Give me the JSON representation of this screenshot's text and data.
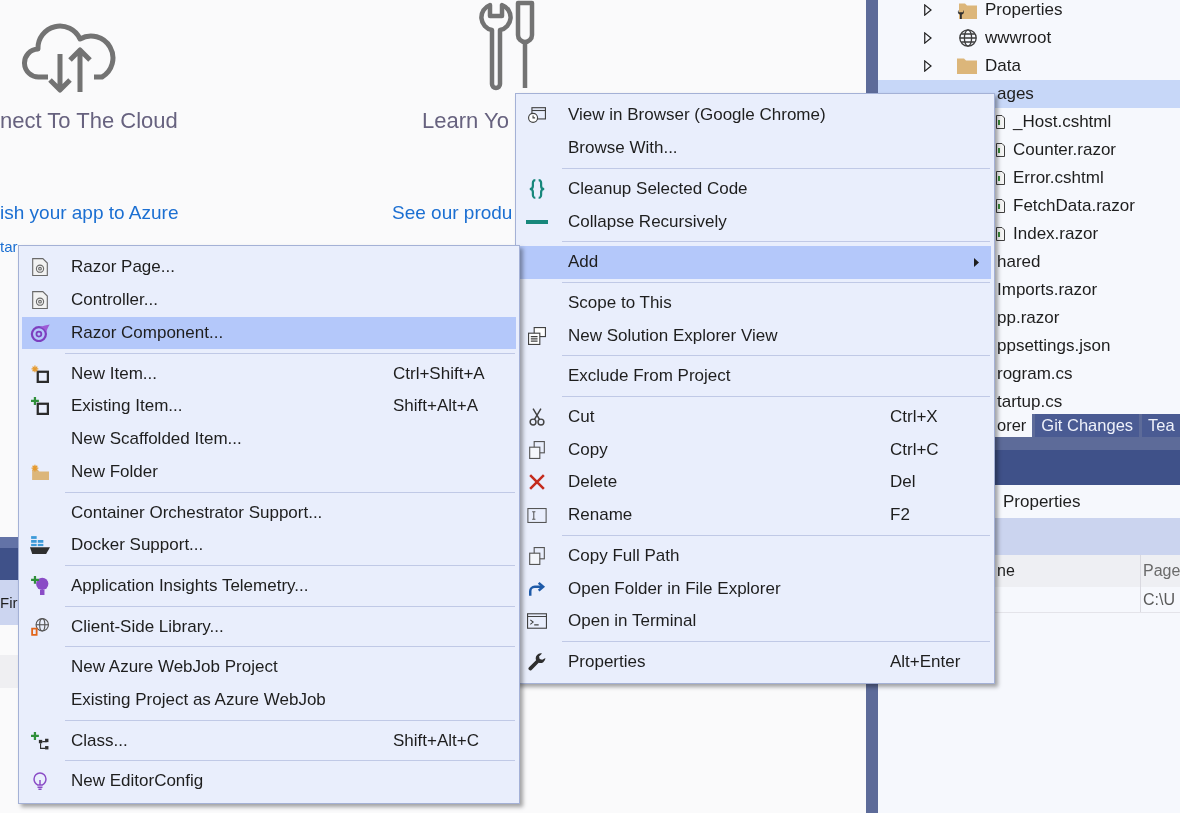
{
  "start_page": {
    "columns": [
      {
        "title": "nect To The Cloud",
        "links": [
          "ish your app to Azure",
          "tar"
        ]
      },
      {
        "title": "Learn Yo",
        "links": [
          "See our produ"
        ]
      }
    ]
  },
  "bottom_panel": {
    "tab": "Fir"
  },
  "solution_explorer": {
    "tree": [
      {
        "label": "Properties",
        "kind": "properties",
        "expanded": false,
        "selected": false
      },
      {
        "label": "wwwroot",
        "kind": "web",
        "expanded": false,
        "selected": false
      },
      {
        "label": "Data",
        "kind": "folder",
        "expanded": false,
        "selected": false
      },
      {
        "label": "ages",
        "selected": true,
        "children": [
          {
            "label": "_Host.cshtml",
            "kind": "file",
            "selected": false
          },
          {
            "label": "Counter.razor",
            "kind": "file",
            "selected": false
          },
          {
            "label": "Error.cshtml",
            "kind": "file",
            "selected": false
          },
          {
            "label": "FetchData.razor",
            "kind": "file",
            "selected": false
          },
          {
            "label": "Index.razor",
            "kind": "file",
            "selected": false
          }
        ]
      },
      {
        "label": "hared",
        "selected": false
      },
      {
        "label": "Imports.razor",
        "selected": false
      },
      {
        "label": "pp.razor",
        "selected": false
      },
      {
        "label": "ppsettings.json",
        "selected": false
      },
      {
        "label": "rogram.cs",
        "selected": false
      },
      {
        "label": "tartup.cs",
        "selected": false
      }
    ]
  },
  "tool_tabs": [
    {
      "label": "orer",
      "selected": true
    },
    {
      "label": "Git Changes",
      "selected": false
    },
    {
      "label": "Tea",
      "selected": false
    }
  ],
  "properties_panel": {
    "title": "Properties",
    "columns": [
      "ne",
      "Page"
    ],
    "rows": [
      {
        "cells": [
          null,
          "C:\\U"
        ]
      }
    ]
  },
  "context_menu": {
    "sections": [
      {
        "items": [
          {
            "label": "View in Browser (Google Chrome)",
            "selected": false,
            "submenu": false
          },
          {
            "label": "Browse With...",
            "selected": false,
            "submenu": false
          }
        ]
      },
      {
        "items": [
          {
            "label": "Cleanup Selected Code",
            "selected": false,
            "submenu": false
          },
          {
            "label": "Collapse Recursively",
            "selected": false,
            "submenu": false
          }
        ]
      },
      {
        "items": [
          {
            "label": "Add",
            "selected": true,
            "submenu": true
          }
        ]
      },
      {
        "items": [
          {
            "label": "Scope to This",
            "selected": false,
            "submenu": false
          },
          {
            "label": "New Solution Explorer View",
            "selected": false,
            "submenu": false
          }
        ]
      },
      {
        "items": [
          {
            "label": "Exclude From Project",
            "selected": false,
            "submenu": false
          }
        ]
      },
      {
        "items": [
          {
            "label": "Cut",
            "shortcut": "Ctrl+X",
            "selected": false,
            "submenu": false
          },
          {
            "label": "Copy",
            "shortcut": "Ctrl+C",
            "selected": false,
            "submenu": false
          },
          {
            "label": "Delete",
            "shortcut": "Del",
            "selected": false,
            "submenu": false
          },
          {
            "label": "Rename",
            "shortcut": "F2",
            "selected": false,
            "submenu": false
          }
        ]
      },
      {
        "items": [
          {
            "label": "Copy Full Path",
            "selected": false,
            "submenu": false
          },
          {
            "label": "Open Folder in File Explorer",
            "selected": false,
            "submenu": false
          },
          {
            "label": "Open in Terminal",
            "selected": false,
            "submenu": false
          }
        ]
      },
      {
        "items": [
          {
            "label": "Properties",
            "shortcut": "Alt+Enter",
            "selected": false,
            "submenu": false
          }
        ]
      }
    ]
  },
  "add_submenu": {
    "sections": [
      {
        "items": [
          {
            "label": "Razor Page...",
            "selected": false
          },
          {
            "label": "Controller...",
            "selected": false
          },
          {
            "label": "Razor Component...",
            "selected": true
          }
        ]
      },
      {
        "items": [
          {
            "label": "New Item...",
            "shortcut": "Ctrl+Shift+A",
            "selected": false
          },
          {
            "label": "Existing Item...",
            "shortcut": "Shift+Alt+A",
            "selected": false
          },
          {
            "label": "New Scaffolded Item...",
            "selected": false
          },
          {
            "label": "New Folder",
            "selected": false
          }
        ]
      },
      {
        "items": [
          {
            "label": "Container Orchestrator Support...",
            "selected": false
          },
          {
            "label": "Docker Support...",
            "selected": false
          }
        ]
      },
      {
        "items": [
          {
            "label": "Application Insights Telemetry...",
            "selected": false
          }
        ]
      },
      {
        "items": [
          {
            "label": "Client-Side Library...",
            "selected": false
          }
        ]
      },
      {
        "items": [
          {
            "label": "New Azure WebJob Project",
            "selected": false
          },
          {
            "label": "Existing Project as Azure WebJob",
            "selected": false
          }
        ]
      },
      {
        "items": [
          {
            "label": "Class...",
            "shortcut": "Shift+Alt+C",
            "selected": false
          }
        ]
      },
      {
        "items": [
          {
            "label": "New EditorConfig",
            "selected": false
          }
        ]
      }
    ]
  }
}
